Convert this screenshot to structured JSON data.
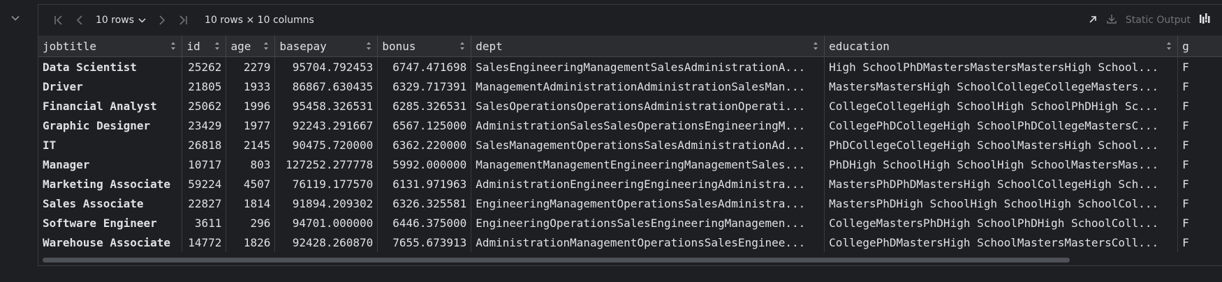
{
  "toolbar": {
    "rows_label": "10 rows",
    "dimensions": "10 rows × 10 columns",
    "static_output": "Static Output"
  },
  "icons": {
    "collapse": "chevron-down-icon",
    "first": "first-page-icon",
    "prev": "previous-page-icon",
    "next": "next-page-icon",
    "last": "last-page-icon",
    "open": "open-in-new-icon",
    "download": "download-icon",
    "chart": "chart-icon"
  },
  "colors": {
    "background": "#1e1f22",
    "header": "#2b2d30",
    "text": "#dfe1e5",
    "muted": "#6f737a",
    "marker": "#c77d20"
  },
  "table": {
    "columns": [
      "jobtitle",
      "id",
      "age",
      "basepay",
      "bonus",
      "dept",
      "education",
      "g"
    ],
    "rows": [
      [
        "Data Scientist",
        "25262",
        "2279",
        "95704.792453",
        "6747.471698",
        "SalesEngineeringManagementSalesAdministrationA...",
        "High SchoolPhDMastersMastersMastersHigh School...",
        "F"
      ],
      [
        "Driver",
        "21805",
        "1933",
        "86867.630435",
        "6329.717391",
        "ManagementAdministrationAdministrationSalesMan...",
        "MastersMastersHigh SchoolCollegeCollegeMasters...",
        "F"
      ],
      [
        "Financial Analyst",
        "25062",
        "1996",
        "95458.326531",
        "6285.326531",
        "SalesOperationsOperationsAdministrationOperati...",
        "CollegeCollegeHigh SchoolHigh SchoolPhDHigh Sc...",
        "F"
      ],
      [
        "Graphic Designer",
        "23429",
        "1977",
        "92243.291667",
        "6567.125000",
        "AdministrationSalesSalesOperationsEngineeringM...",
        "CollegePhDCollegeHigh SchoolPhDCollegeMastersC...",
        "F"
      ],
      [
        "IT",
        "26818",
        "2145",
        "90475.720000",
        "6362.220000",
        "SalesManagementOperationsSalesAdministrationAd...",
        "PhDCollegeCollegeHigh SchoolMastersHigh School...",
        "F"
      ],
      [
        "Manager",
        "10717",
        "803",
        "127252.277778",
        "5992.000000",
        "ManagementManagementEngineeringManagementSales...",
        "PhDHigh SchoolHigh SchoolHigh SchoolMastersMas...",
        "F"
      ],
      [
        "Marketing Associate",
        "59224",
        "4507",
        "76119.177570",
        "6131.971963",
        "AdministrationEngineeringEngineeringAdministra...",
        "MastersPhDPhDMastersHigh SchoolCollegeHigh Sch...",
        "F"
      ],
      [
        "Sales Associate",
        "22827",
        "1814",
        "91894.209302",
        "6326.325581",
        "EngineeringManagementOperationsSalesAdministra...",
        "MastersPhDHigh SchoolHigh SchoolHigh SchoolCol...",
        "F"
      ],
      [
        "Software Engineer",
        "3611",
        "296",
        "94701.000000",
        "6446.375000",
        "EngineeringOperationsSalesEngineeringManagemen...",
        "CollegeMastersPhDHigh SchoolPhDHigh SchoolColl...",
        "F"
      ],
      [
        "Warehouse Associate",
        "14772",
        "1826",
        "92428.260870",
        "7655.673913",
        "AdministrationManagementOperationsSalesEnginee...",
        "CollegePhDMastersHigh SchoolMastersMastersColl...",
        "F"
      ]
    ]
  }
}
